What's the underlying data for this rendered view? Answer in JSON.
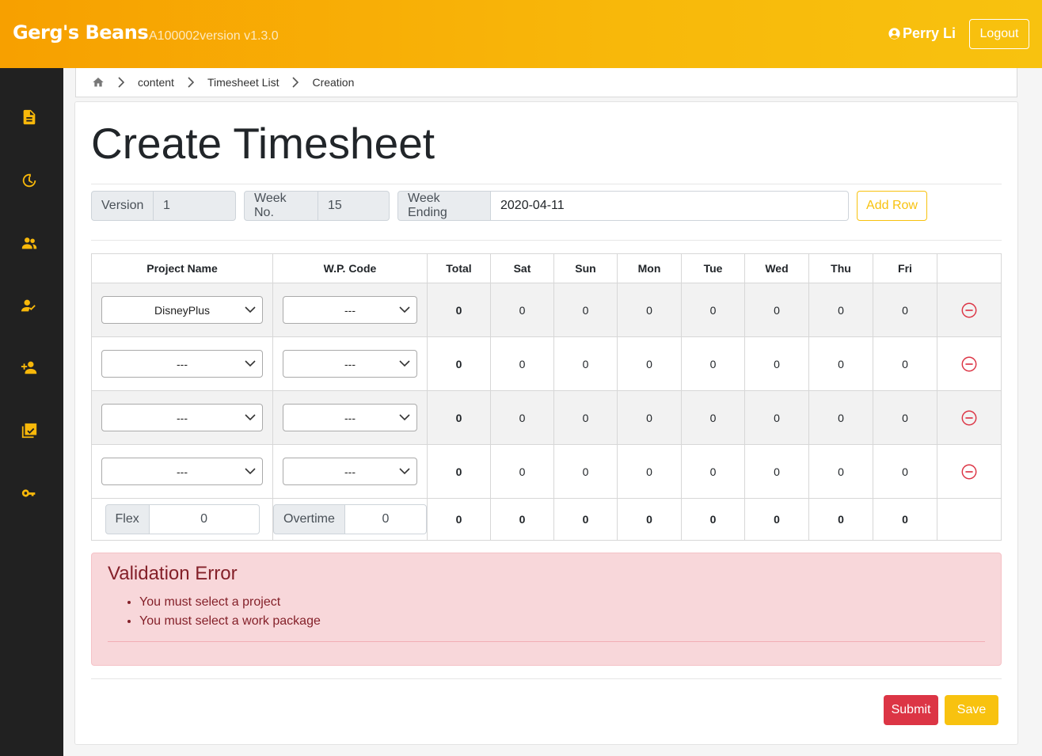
{
  "header": {
    "brand": "Gerg's Beans",
    "version": "A100002version v1.3.0",
    "user": "Perry Li",
    "logout": "Logout"
  },
  "sidebar": {
    "items": [
      {
        "icon": "document-icon"
      },
      {
        "icon": "timer-icon"
      },
      {
        "icon": "people-icon"
      },
      {
        "icon": "person-check-icon"
      },
      {
        "icon": "person-add-icon"
      },
      {
        "icon": "checklist-icon"
      },
      {
        "icon": "key-icon"
      }
    ]
  },
  "breadcrumb": [
    "content",
    "Timesheet List",
    "Creation"
  ],
  "page": {
    "title": "Create Timesheet",
    "version_label": "Version",
    "version_value": "1",
    "weekno_label": "Week No.",
    "weekno_value": "15",
    "weekending_label": "Week Ending",
    "weekending_value": "2020-04-11",
    "add_row": "Add Row"
  },
  "table": {
    "headers": [
      "Project Name",
      "W.P. Code",
      "Total",
      "Sat",
      "Sun",
      "Mon",
      "Tue",
      "Wed",
      "Thu",
      "Fri",
      ""
    ],
    "rows": [
      {
        "project": "DisneyPlus",
        "wp": "---",
        "total": "0",
        "days": [
          "0",
          "0",
          "0",
          "0",
          "0",
          "0",
          "0"
        ]
      },
      {
        "project": "---",
        "wp": "---",
        "total": "0",
        "days": [
          "0",
          "0",
          "0",
          "0",
          "0",
          "0",
          "0"
        ]
      },
      {
        "project": "---",
        "wp": "---",
        "total": "0",
        "days": [
          "0",
          "0",
          "0",
          "0",
          "0",
          "0",
          "0"
        ]
      },
      {
        "project": "---",
        "wp": "---",
        "total": "0",
        "days": [
          "0",
          "0",
          "0",
          "0",
          "0",
          "0",
          "0"
        ]
      }
    ],
    "flex_label": "Flex",
    "flex_value": "0",
    "overtime_label": "Overtime",
    "overtime_value": "0",
    "totals": [
      "0",
      "0",
      "0",
      "0",
      "0",
      "0",
      "0",
      "0"
    ]
  },
  "alert": {
    "title": "Validation Error",
    "messages": [
      "You must select a project",
      "You must select a work package"
    ]
  },
  "actions": {
    "submit": "Submit",
    "save": "Save"
  },
  "colors": {
    "accent": "#f8c20f",
    "danger": "#dc3545",
    "sidebar": "#212121"
  }
}
